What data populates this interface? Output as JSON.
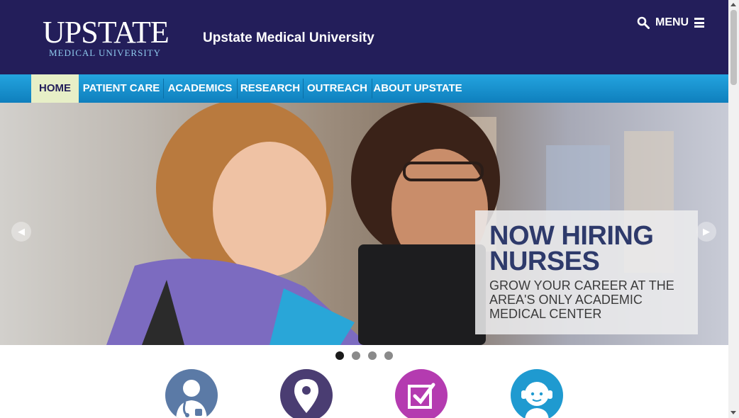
{
  "header": {
    "logo_word": "UPSTATE",
    "logo_sub": "MEDICAL UNIVERSITY",
    "site_name": "Upstate Medical University",
    "menu_label": "MENU",
    "search_icon": "search-icon",
    "menu_icon": "hamburger-icon"
  },
  "nav": {
    "items": [
      {
        "label": "HOME",
        "active": true
      },
      {
        "label": "PATIENT CARE"
      },
      {
        "label": "ACADEMICS"
      },
      {
        "label": "RESEARCH"
      },
      {
        "label": "OUTREACH"
      },
      {
        "label": "ABOUT UPSTATE"
      }
    ]
  },
  "hero": {
    "prev_icon": "chevron-left-icon",
    "next_icon": "chevron-right-icon",
    "headline": "NOW HIRING NURSES",
    "subtext": "GROW YOUR CAREER AT THE AREA'S ONLY ACADEMIC MEDICAL CENTER",
    "slide_count": 4,
    "active_slide": 1
  },
  "quick_links": {
    "icons": [
      {
        "icon": "doctor-icon",
        "color": "#5b7aa6"
      },
      {
        "icon": "location-pin-icon",
        "color": "#4a3d72"
      },
      {
        "icon": "checkbox-icon",
        "color": "#b43bb0"
      },
      {
        "icon": "headset-operator-icon",
        "color": "#1f9ad0"
      }
    ]
  },
  "colors": {
    "header_bg": "#231e5a",
    "nav_bg": "#1c93d0",
    "nav_active_bg": "#e7efc7",
    "headline": "#2e3a6b"
  }
}
